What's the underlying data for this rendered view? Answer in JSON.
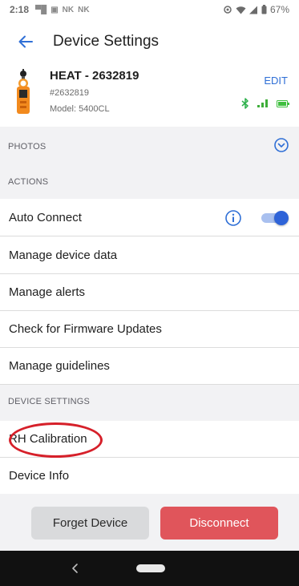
{
  "status_bar": {
    "time": "2:18",
    "notifications": [
      "▀█",
      "▣",
      "NK",
      "NK"
    ],
    "battery": "67%"
  },
  "header": {
    "title": "Device Settings"
  },
  "device": {
    "name": "HEAT - 2632819",
    "id": "#2632819",
    "model": "Model: 5400CL",
    "edit_label": "EDIT"
  },
  "sections": {
    "photos": "PHOTOS",
    "actions": "ACTIONS",
    "device_settings": "DEVICE SETTINGS"
  },
  "actions": [
    {
      "label": "Auto Connect",
      "toggle_on": true
    },
    {
      "label": "Manage device data"
    },
    {
      "label": "Manage alerts"
    },
    {
      "label": "Check for Firmware Updates"
    },
    {
      "label": "Manage guidelines"
    }
  ],
  "device_settings": [
    {
      "label": "RH Calibration"
    },
    {
      "label": "Device Info"
    }
  ],
  "buttons": {
    "forget": "Forget Device",
    "disconnect": "Disconnect"
  },
  "colors": {
    "accent": "#2e63d8",
    "bluetooth": "#2bb04a",
    "signal": "#3fae3a",
    "battery": "#3fbf3f",
    "disconnect": "#e0555b",
    "highlight": "#d6202a"
  }
}
